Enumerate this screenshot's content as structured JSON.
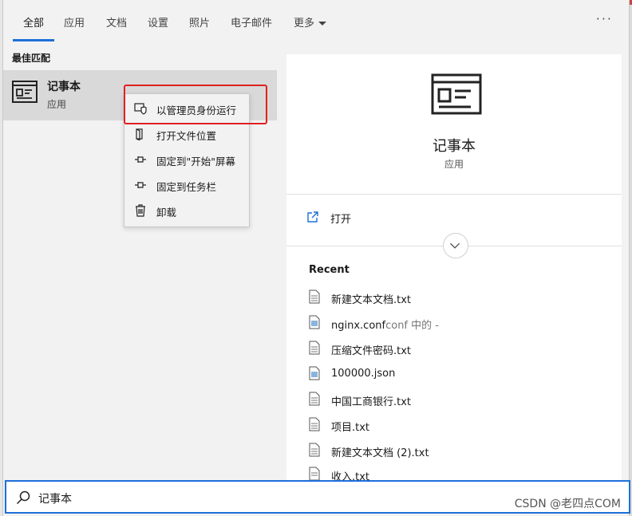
{
  "tabs": [
    {
      "label": "全部",
      "active": true
    },
    {
      "label": "应用"
    },
    {
      "label": "文档"
    },
    {
      "label": "设置"
    },
    {
      "label": "照片"
    },
    {
      "label": "电子邮件"
    },
    {
      "label": "更多"
    }
  ],
  "more_icon": "ellipsis-icon",
  "best_match": {
    "section_title": "最佳匹配",
    "name": "记事本",
    "type": "应用"
  },
  "context_menu": [
    {
      "label": "以管理员身份运行",
      "icon": "shield-icon"
    },
    {
      "label": "打开文件位置",
      "icon": "folder-icon"
    },
    {
      "label": "固定到\"开始\"屏幕",
      "icon": "pin-icon"
    },
    {
      "label": "固定到任务栏",
      "icon": "pin-icon"
    },
    {
      "label": "卸载",
      "icon": "trash-icon"
    }
  ],
  "detail": {
    "name": "记事本",
    "type": "应用",
    "open_label": "打开",
    "recent_title": "Recent",
    "recent": [
      {
        "name": "新建文本文档.txt",
        "suffix": ""
      },
      {
        "name": "nginx.conf",
        "suffix": "conf 中的 -"
      },
      {
        "name": "压缩文件密码.txt",
        "suffix": ""
      },
      {
        "name": "100000.json",
        "suffix": ""
      },
      {
        "name": "中国工商银行.txt",
        "suffix": ""
      },
      {
        "name": "项目.txt",
        "suffix": ""
      },
      {
        "name": "新建文本文档 (2).txt",
        "suffix": ""
      },
      {
        "name": "收入.txt",
        "suffix": ""
      }
    ]
  },
  "search": {
    "value": "记事本"
  },
  "watermark": "CSDN @老四点COM",
  "colors": {
    "accent": "#1e6fd9",
    "highlight": "#e02020"
  }
}
